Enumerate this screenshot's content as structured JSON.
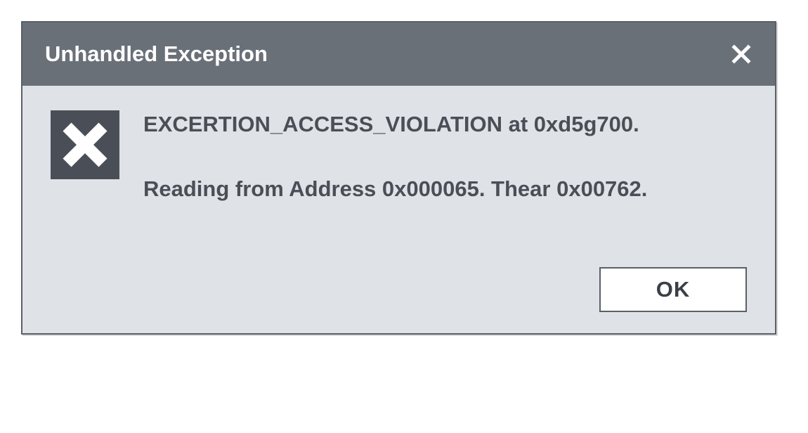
{
  "dialog": {
    "title": "Unhandled Exception",
    "message_line_1": "EXCERTION_ACCESS_VIOLATION at 0xd5g700.",
    "message_line_2": "Reading from Address 0x000065. Thear 0x00762.",
    "ok_label": "OK"
  }
}
